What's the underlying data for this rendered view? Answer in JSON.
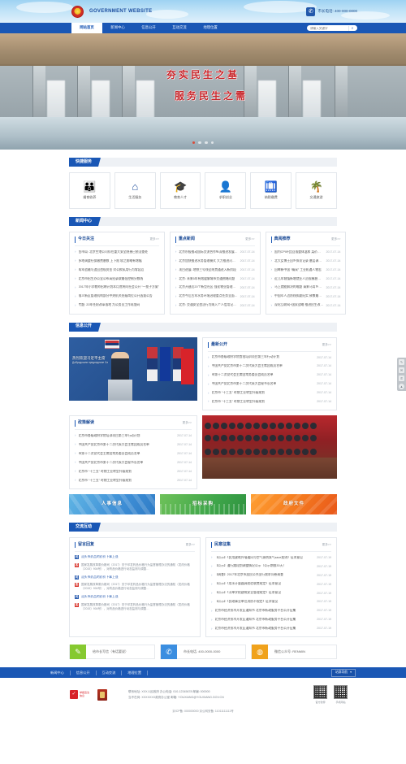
{
  "header": {
    "emblem_icon": "national-emblem-icon",
    "site_name": "GOVERNMENT WEBSITE",
    "phone_icon": "telephone-icon",
    "phone_text": "市长电话: 400-000-0000"
  },
  "nav": {
    "items": [
      {
        "label": "网站首页",
        "active": true
      },
      {
        "label": "新闻中心",
        "active": false
      },
      {
        "label": "信息公开",
        "active": false
      },
      {
        "label": "互动交流",
        "active": false
      },
      {
        "label": "地理位置",
        "active": false
      }
    ],
    "search_placeholder": "请输入关键字",
    "search_value": "",
    "search_icon": "search-icon"
  },
  "hero": {
    "line1": "夯实民生之基",
    "line2": "服务民生之需",
    "dots": 4,
    "active_dot": 0
  },
  "quick_service": {
    "title": "快捷服务",
    "items": [
      {
        "icon": "family-services-icon",
        "glyph": "👪",
        "label": "婚育收养"
      },
      {
        "icon": "home-life-icon",
        "glyph": "🏠",
        "label": "生活服务"
      },
      {
        "icon": "graduation-cap-icon",
        "glyph": "🎓",
        "label": "教育人才"
      },
      {
        "icon": "job-seeker-icon",
        "glyph": "👤",
        "label": "求职创业"
      },
      {
        "icon": "tax-icon",
        "glyph": "💼",
        "label": "纳税缴费"
      },
      {
        "icon": "travel-palm-icon",
        "glyph": "🌴",
        "label": "交通旅游"
      }
    ]
  },
  "news_center": {
    "title": "新闻中心",
    "more_label": "更多>>",
    "columns": [
      {
        "title": "今日关注",
        "items": [
          "金市局: 北京空港公司存在重大安全隐患已依法查处",
          "多地调整社保缴费基数 上下限 较之前略有增幅",
          "两年追缴与追回违规资金 对公款私用行为零容忍",
          "北京市招生办公室公布高招录取最低控制分数线",
          "2017年小学教师招聘计划本月底将向社会公开 “一揽子方案”",
          "顺义新区管理机构部分中央机关处级岗位公开选拔公告",
          "专题: 20年任职改革落地 为公务员工作再加码"
        ]
      },
      {
        "title": "重点新闻",
        "items": [
          {
            "text": "北京积极推动国际交流合作纵深推进发展成果",
            "date": "2017-07-14"
          },
          {
            "text": "北京加快推进水务管理模式 大力推进河长制度",
            "date": "2017-07-14"
          },
          {
            "text": "项目进展: 地铁三号线全线贯通进入新阶段",
            "date": "2017-07-14"
          },
          {
            "text": "北京: 未来5年有效缓解城市交通拥堵问题",
            "date": "2017-07-14"
          },
          {
            "text": "北京开建近20个新型社区 强化物业管理服务体系",
            "date": "2017-07-14"
          },
          {
            "text": "北京今后五年水务环境治理重点任务全面启动",
            "date": "2017-07-14"
          },
          {
            "text": "北京: 交通安全违法行为纳入个人信用记录体系",
            "date": "2017-07-14"
          }
        ]
      },
      {
        "title": "典阅推荐",
        "items": [
          {
            "text": "国内CPI环比回落整体温和 菜价上涨明显",
            "date": "2017-07-14"
          },
          {
            "text": "北大女博士回乡探访记录 基层调查走笔",
            "date": "2017-07-14"
          },
          {
            "text": "回眸新中国 “精采” 工业机遇人物志",
            "date": "2017-07-14"
          },
          {
            "text": "近几年城镇新增就业人员规模稳中有增",
            "date": "2017-07-14"
          },
          {
            "text": "马上就能解决的难题 请来马背乡亲说说",
            "date": "2017-07-14"
          },
          {
            "text": "中国军人边防线执勤纪实 致敬最可爱的人",
            "date": "2017-07-14"
          },
          {
            "text": "深化互联网+国家战略 推进民生改善升级",
            "date": "2017-07-14"
          }
        ]
      }
    ]
  },
  "info_disclosure": {
    "title": "信息公开",
    "photo": {
      "name": "leader-speech-photo",
      "caption": "热烈欢迎习近平主席",
      "sub_caption": "Добродошли председниче Си"
    },
    "panel": {
      "title": "最新公开",
      "more_label": "更多>>",
      "items": [
        {
          "text": "北京市各级政府学院首批培训项目第三年行动计划",
          "date": "2017-07-14"
        },
        {
          "text": "中国共产党北京市第十二次代表大会主席团成员名单",
          "date": "2017-07-14"
        },
        {
          "text": "市第十二次党代会主席团常务委员会成员名单",
          "date": "2017-07-14"
        },
        {
          "text": "中国共产党北京市第十二次代表大会秘书长名单",
          "date": "2017-07-14"
        },
        {
          "text": "北京市 “十三五” 时期工业转型升级规划",
          "date": "2017-07-14"
        },
        {
          "text": "北京市 “十三五” 时期工业转型升级规划",
          "date": "2017-07-14"
        }
      ]
    }
  },
  "policy": {
    "panel": {
      "title": "政策解读",
      "more_label": "更多>>",
      "items": [
        {
          "text": "北京市各级政府学院培训项目第三年行动计划",
          "date": "2017-07-14"
        },
        {
          "text": "中国共产党北京市第十二次代表大会主席团成员名单",
          "date": "2017-07-14"
        },
        {
          "text": "市第十二次党代会主席团常务委员会成员名单",
          "date": "2017-07-14"
        },
        {
          "text": "中国共产党北京市第十二次代表大会秘书长名单",
          "date": "2017-07-14"
        },
        {
          "text": "北京市 “十三五” 时期工业转型升级规划",
          "date": "2017-07-14"
        },
        {
          "text": "北京市 “十三五” 时期工业转型升级规划",
          "date": "2017-07-14"
        }
      ]
    },
    "photo": {
      "name": "conference-hall-photo"
    }
  },
  "banners": [
    {
      "label": "人事信息",
      "color": "#3f8fd6",
      "name": "banner-personnel"
    },
    {
      "label": "招标采购",
      "color": "#3fa64a",
      "name": "banner-procurement"
    },
    {
      "label": "政府文件",
      "color": "#f4781e",
      "name": "banner-documents"
    }
  ],
  "interaction": {
    "title": "交流互动",
    "reply_panel": {
      "title": "留言回复",
      "more_label": "更多>>",
      "items": [
        {
          "q_badge": "问",
          "question": "汕头市药品的药价下事上涨",
          "a_badge": "答",
          "answer": "国家发展改革委价格司（2017）关于印发药品价格行为监督管理办法的通知（发改价格〔2015〕904号），对药品价格进行动态监测与调整…"
        },
        {
          "q_badge": "问",
          "question": "汕头市药品的药价下事上涨",
          "a_badge": "答",
          "answer": "国家发展改革委价格司（2017）关于印发药品价格行为监督管理办法的通知（发改价格〔2015〕904号），对药品价格进行动态监测与调整…"
        },
        {
          "q_badge": "问",
          "question": "汕头市药品的药价下事上涨",
          "a_badge": "答",
          "answer": "国家发展改革委价格司（2017）关于印发药品价格行为监督管理办法的通知（发改价格〔2015〕904号），对药品价格进行动态监测与调整…"
        }
      ]
    },
    "opinion_panel": {
      "title": "民意征集",
      "more_label": "更多>>",
      "items": [
        {
          "text": "【公示】《民用建筑外墙通风与空气源热泵气засе准则》征求意见",
          "date": "2017-07-19"
        },
        {
          "text": "【公示】通行路段划调整情况公示（公示期限30天）",
          "date": "2017-07-19"
        },
        {
          "text": "【调查】2017年北京市居民公共出行需求问卷调查",
          "date": "2017-07-19"
        },
        {
          "text": "【公示】《用水计量器具校验收费规定》征求意见",
          "date": "2017-07-19"
        },
        {
          "text": "【公示】《河单学校建筑安全管理规定》征求意见",
          "date": "2017-07-19"
        },
        {
          "text": "【公示】《民政事业单位消防不规定》征求意见",
          "date": "2017-07-19"
        },
        {
          "text": "北京市经济技术开发区通知书 北京市新政服务平台公开征集",
          "date": "2017-07-19"
        },
        {
          "text": "北京市经济技术开发区通知书 北京市新政服务平台公开征集",
          "date": "2017-07-19"
        },
        {
          "text": "北京市经济技术开发区通知书 北京市新政服务平台公开征集",
          "date": "2017-07-19"
        }
      ]
    }
  },
  "contacts": [
    {
      "icon": "pencil-write-icon",
      "glyph": "✎",
      "label": "给市长写信（有话要说）",
      "color": "#86c930",
      "name": "contact-write-letter"
    },
    {
      "icon": "phone-ring-icon",
      "glyph": "✆",
      "label": "市长电话: 400-0000-0000",
      "color": "#3b8ee0",
      "name": "contact-hotline"
    },
    {
      "icon": "wechat-icon",
      "glyph": "◉",
      "label": "微信公众号: RENMIN",
      "color": "#f0a21c",
      "name": "contact-wechat"
    }
  ],
  "footer": {
    "links": [
      "新闻中心",
      "信息公开",
      "互动交流",
      "地理位置"
    ],
    "select_label": "站群导航",
    "select_icon": "chevron-down-icon",
    "logos": [
      {
        "name": "report-illegal-logo",
        "caption": "举报违法\n信息"
      },
      {
        "name": "police-shield-logo",
        "caption": ""
      }
    ],
    "info_lines": [
      "联系地址: XXX人民政府    办公电话: 010-12345678  邮编: 000000",
      "当不在岗: XXXXXXX政府办公室    邮箱: YOUXIANG@YOUXIANG.GOV.CN"
    ],
    "qr_codes": [
      {
        "name": "wechat-qr",
        "caption": "官方微博"
      },
      {
        "name": "weibo-qr",
        "caption": "手机网站"
      }
    ],
    "copyright": "京ICP备: 000000000    京公网安备: 11011111111号"
  },
  "side_toolbar": {
    "items": [
      {
        "name": "edit-tool-icon",
        "glyph": "✎"
      },
      {
        "name": "message-tool-icon",
        "glyph": "✉"
      },
      {
        "name": "phone-tool-icon",
        "glyph": "✆"
      },
      {
        "name": "back-to-top-icon",
        "glyph": "▲"
      }
    ]
  }
}
